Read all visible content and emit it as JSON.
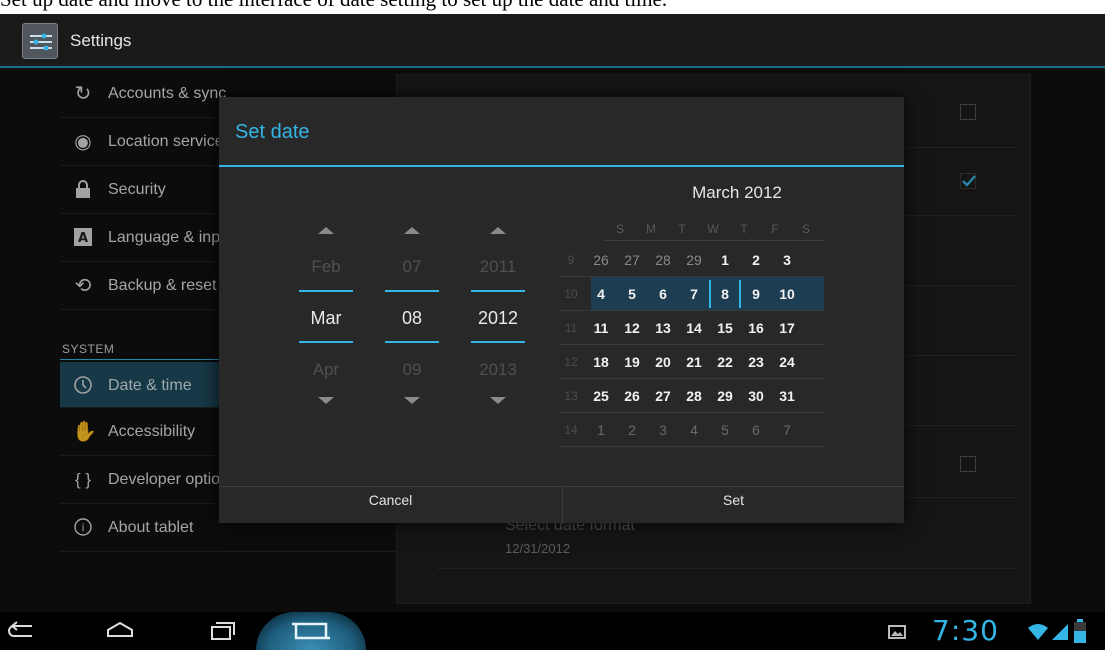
{
  "caption": "Set up date and move to the interface of date setting to set up the date and time.",
  "actionbar": {
    "title": "Settings",
    "icon": "settings-sliders-icon"
  },
  "sidebar": {
    "items": [
      {
        "label": "Accounts & sync",
        "icon": "sync-icon"
      },
      {
        "label": "Location services",
        "icon": "location-icon"
      },
      {
        "label": "Security",
        "icon": "lock-icon"
      },
      {
        "label": "Language & input",
        "icon": "keyboard-icon"
      },
      {
        "label": "Backup & reset",
        "icon": "backup-icon"
      },
      {
        "label": "Date & time",
        "icon": "clock-icon",
        "active": true
      },
      {
        "label": "Accessibility",
        "icon": "hand-icon"
      },
      {
        "label": "Developer options",
        "icon": "braces-icon"
      },
      {
        "label": "About tablet",
        "icon": "info-icon"
      }
    ],
    "section_header": "SYSTEM"
  },
  "detail": {
    "select_date_format": "Select date format",
    "date_format_value": "12/31/2012"
  },
  "dialog": {
    "title": "Set date",
    "spinners": {
      "month": {
        "prev": "Feb",
        "current": "Mar",
        "next": "Apr"
      },
      "day": {
        "prev": "07",
        "current": "08",
        "next": "09"
      },
      "year": {
        "prev": "2011",
        "current": "2012",
        "next": "2013"
      }
    },
    "calendar": {
      "title": "March 2012",
      "weekdays": [
        "S",
        "M",
        "T",
        "W",
        "T",
        "F",
        "S"
      ],
      "weeks": [
        {
          "num": "9",
          "days": [
            "26",
            "27",
            "28",
            "29",
            "1",
            "2",
            "3"
          ]
        },
        {
          "num": "10",
          "days": [
            "4",
            "5",
            "6",
            "7",
            "8",
            "9",
            "10"
          ]
        },
        {
          "num": "11",
          "days": [
            "11",
            "12",
            "13",
            "14",
            "15",
            "16",
            "17"
          ]
        },
        {
          "num": "12",
          "days": [
            "18",
            "19",
            "20",
            "21",
            "22",
            "23",
            "24"
          ]
        },
        {
          "num": "13",
          "days": [
            "25",
            "26",
            "27",
            "28",
            "29",
            "30",
            "31"
          ]
        },
        {
          "num": "14",
          "days": [
            "1",
            "2",
            "3",
            "4",
            "5",
            "6",
            "7"
          ]
        }
      ],
      "selected_day": "8"
    },
    "cancel_label": "Cancel",
    "set_label": "Set"
  },
  "statusbar": {
    "time": "7:30"
  },
  "colors": {
    "accent": "#33b5e5",
    "dialog_bg": "#282828",
    "screen_bg": "#111111"
  }
}
